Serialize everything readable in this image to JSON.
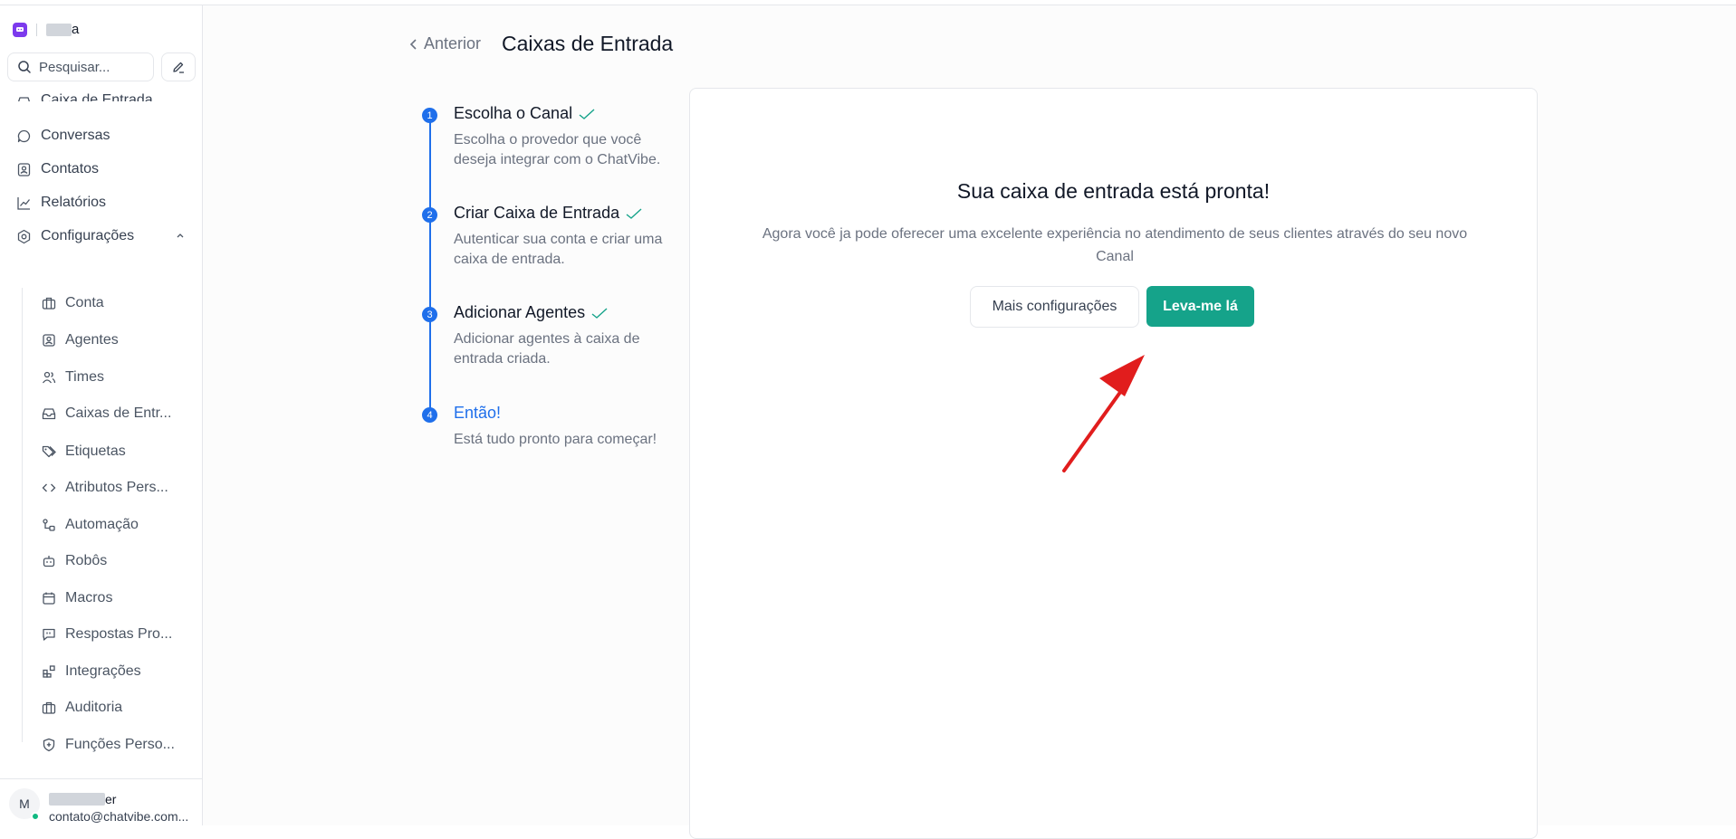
{
  "sidebar": {
    "brand_suffix": "a",
    "search_placeholder": "Pesquisar...",
    "nav": {
      "inbox": "Caixa de Entrada",
      "conversations": "Conversas",
      "contacts": "Contatos",
      "reports": "Relatórios",
      "settings": "Configurações"
    },
    "settings_items": [
      "Conta",
      "Agentes",
      "Times",
      "Caixas de Entr...",
      "Etiquetas",
      "Atributos Pers...",
      "Automação",
      "Robôs",
      "Macros",
      "Respostas Pro...",
      "Integrações",
      "Auditoria",
      "Funções Perso..."
    ],
    "user": {
      "initial": "M",
      "name_suffix": "er",
      "email": "contato@chatvibe.com..."
    }
  },
  "header": {
    "back_label": "Anterior",
    "title": "Caixas de Entrada"
  },
  "steps": [
    {
      "number": "1",
      "title": "Escolha o Canal",
      "description": "Escolha o provedor que você deseja integrar com o ChatVibe.",
      "done": true
    },
    {
      "number": "2",
      "title": "Criar Caixa de Entrada",
      "description": "Autenticar sua conta e criar uma caixa de entrada.",
      "done": true
    },
    {
      "number": "3",
      "title": "Adicionar Agentes",
      "description": "Adicionar agentes à caixa de entrada criada.",
      "done": true
    },
    {
      "number": "4",
      "title": "Então!",
      "description": "Está tudo pronto para começar!",
      "done": false
    }
  ],
  "card": {
    "title": "Sua caixa de entrada está pronta!",
    "text": "Agora você ja pode oferecer uma excelente experiência no atendimento de seus clientes através do seu novo Canal",
    "more_button": "Mais configurações",
    "go_button": "Leva-me lá"
  },
  "colors": {
    "accent": "#1f6feb",
    "primary_button": "#15a38a",
    "annotation_arrow": "#e11d1d"
  }
}
